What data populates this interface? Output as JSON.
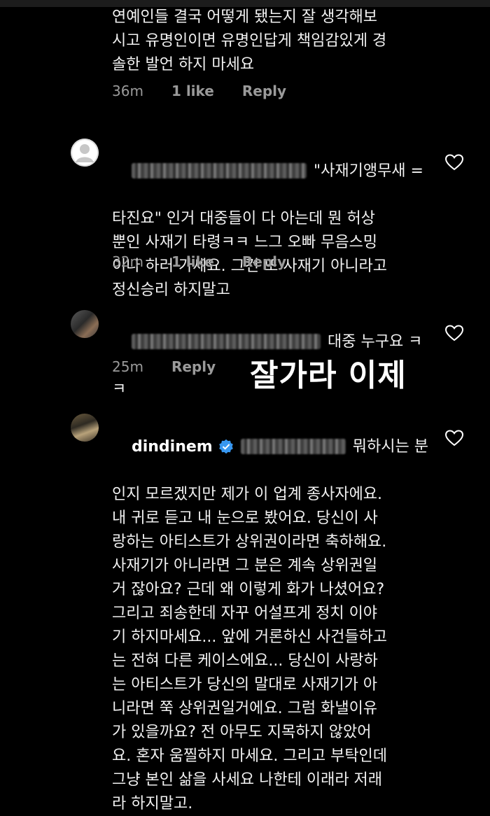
{
  "comments": [
    {
      "text_lines": [
        "연예인들 결국 어떻게 됐는지 잘 생각해보",
        "시고 유명인이면 유명인답게 책임감있게 경",
        "솔한 발언 하지 마세요"
      ],
      "time": "36m",
      "likes": "1 like",
      "reply_label": "Reply"
    },
    {
      "lead_text": "\"사재기앵무새 =",
      "text_lines": [
        "타진요\" 인거 대중들이 다 아는데 뭔 허상",
        "뿐인 사재기 타령ㅋㅋ 느그 오빠 무음스밍",
        "이나 하러 가세요. 그건 또 사재기 아니라고",
        "정신승리 하지말고"
      ],
      "time": "32m",
      "likes": "1 like",
      "reply_label": "Reply"
    },
    {
      "lead_text": "대중 누구요 ㅋ",
      "text_lines": [
        "ㅋ"
      ],
      "time": "25m",
      "reply_label": "Reply"
    },
    {
      "username": "dindinem",
      "lead_text": "뭐하시는 분",
      "text_lines": [
        "인지 모르겠지만 제가 이 업계 종사자에요.",
        "내 귀로 듣고 내 눈으로 봤어요. 당신이 사",
        "랑하는 아티스트가 상위권이라면 축하해요.",
        "사재기가 아니라면 그 분은 계속 상위권일",
        "거 잖아요? 근데 왜 이렇게 화가 나셨어요?",
        "그리고 죄송한데 자꾸 어설프게 정치 이야",
        "기 하지마세요... 앞에 거론하신 사건들하고",
        "는 전혀 다른 케이스에요... 당신이 사랑하",
        "는 아티스트가 당신의 말대로 사재기가 아",
        "니라면 쭉 상위권일거에요. 그럼 화낼이유",
        "가 있을까요? 전 아무도 지목하지 않았어",
        "요. 혼자 움찔하지 마세요. 그리고 부탁인데",
        "그냥 본인 삶을 사세요 나한테 이래라 저래",
        "라 하지말고."
      ]
    }
  ],
  "overlay_caption": "잘가라 이제",
  "icons": {
    "heart": "heart-outline-icon",
    "verified": "verified-badge-icon",
    "avatar_default": "default-avatar-icon"
  },
  "colors": {
    "background": "#000000",
    "meta": "#9a9a9a",
    "verified": "#3897f0"
  }
}
